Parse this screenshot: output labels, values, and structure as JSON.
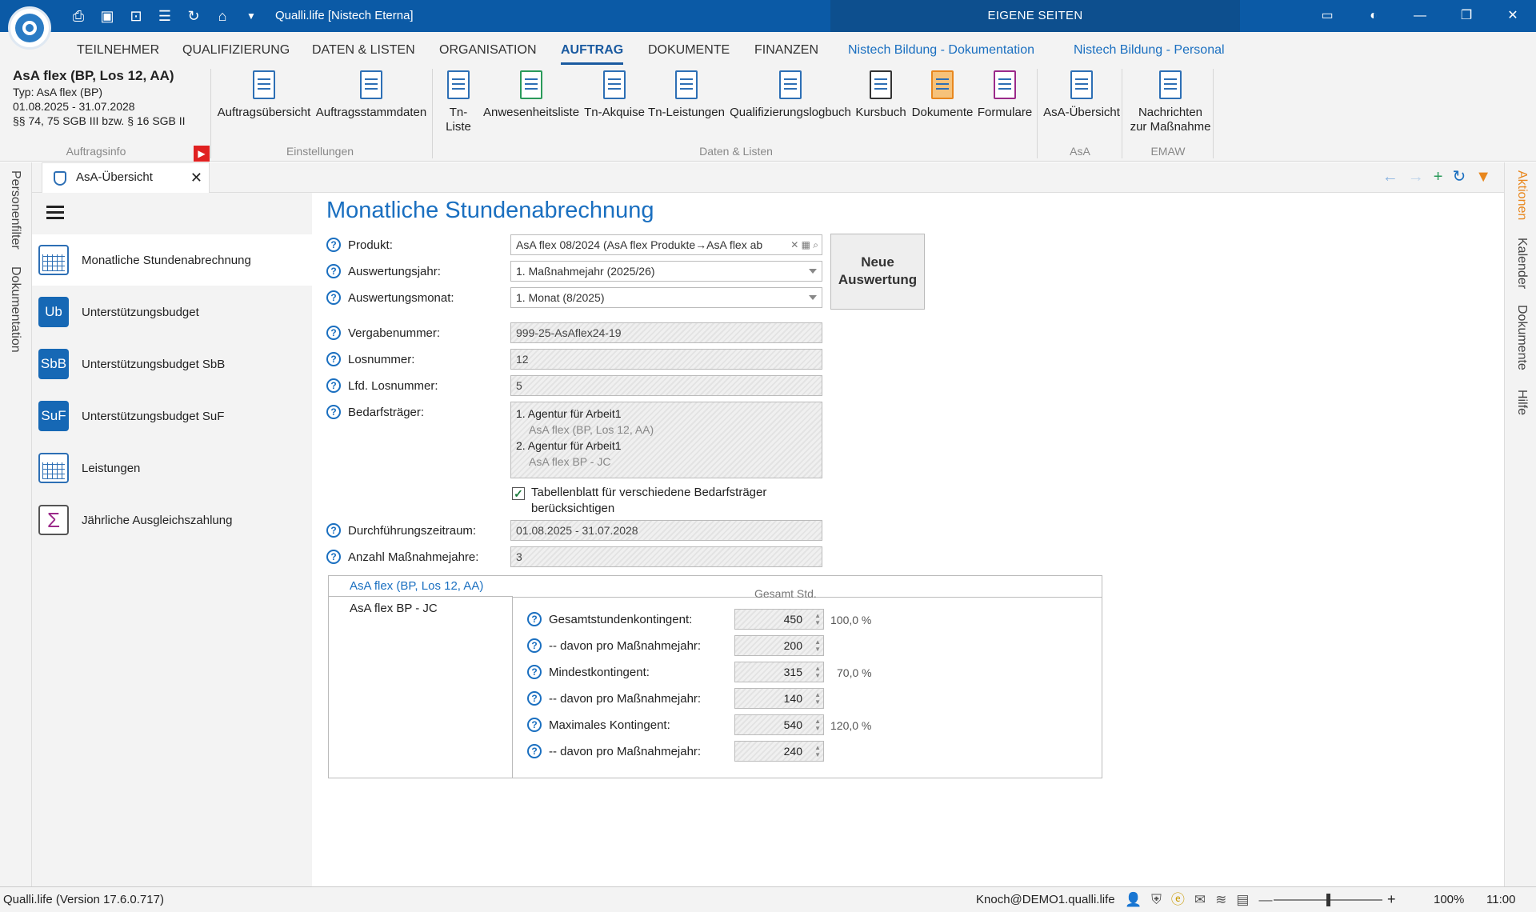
{
  "app": {
    "title": "Qualli.life [Nistech Eterna]",
    "eigene": "EIGENE SEITEN"
  },
  "menu": [
    "TEILNEHMER",
    "QUALIFIZIERUNG",
    "DATEN & LISTEN",
    "ORGANISATION",
    "AUFTRAG",
    "DOKUMENTE",
    "FINANZEN",
    "Nistech Bildung - Dokumentation",
    "Nistech Bildung - Personal"
  ],
  "auftrag": {
    "title": "AsA flex (BP, Los 12, AA)",
    "typ": "Typ: AsA flex (BP)",
    "zeit": "01.08.2025 - 31.07.2028",
    "recht": "§§ 74, 75 SGB III bzw. § 16 SGB II"
  },
  "ribbon": {
    "groups": {
      "auftragsinfo": "Auftragsinfo",
      "einstellungen": "Einstellungen",
      "daten": "Daten & Listen",
      "asa": "AsA",
      "emaw": "EMAW"
    },
    "buttons": {
      "b1": "Auftragsübersicht",
      "b2": "Auftragsstammdaten",
      "b3": "Tn-Liste",
      "b4": "Anwesenheitsliste",
      "b5": "Tn-Akquise",
      "b6": "Tn-Leistungen",
      "b7": "Qualifizierungslogbuch",
      "b8": "Kursbuch",
      "b9": "Dokumente",
      "b10": "Formulare",
      "b11": "AsA-Übersicht",
      "b12a": "Nachrichten",
      "b12b": "zur Maßnahme"
    }
  },
  "side_left": {
    "a": "Personenfilter",
    "b": "Dokumentation"
  },
  "side_right": {
    "a": "Aktionen",
    "b": "Kalender",
    "c": "Dokumente",
    "d": "Hilfe"
  },
  "tab": {
    "label": "AsA-Übersicht"
  },
  "sidebar": [
    {
      "label": "Monatliche Stundenabrechnung",
      "icon": "calendar-grid-icon"
    },
    {
      "label": "Unterstützungsbudget",
      "badge": "Ub"
    },
    {
      "label": "Unterstützungsbudget SbB",
      "badge": "SbB"
    },
    {
      "label": "Unterstützungsbudget SuF",
      "badge": "SuF"
    },
    {
      "label": "Leistungen",
      "icon": "calculator-icon"
    },
    {
      "label": "Jährliche Ausgleichszahlung",
      "icon": "sigma-icon"
    }
  ],
  "form": {
    "title": "Monatliche Stundenabrechnung",
    "produkt_l": "Produkt:",
    "produkt_v": "AsA flex 08/2024 (AsA flex Produkte→AsA flex ab",
    "jahr_l": "Auswertungsjahr:",
    "jahr_v": "1. Maßnahmejahr (2025/26)",
    "monat_l": "Auswertungsmonat:",
    "monat_v": "1. Monat (8/2025)",
    "neue1": "Neue",
    "neue2": "Auswertung",
    "vergabe_l": "Vergabenummer:",
    "vergabe_v": "999-25-AsAflex24-19",
    "los_l": "Losnummer:",
    "los_v": "12",
    "lfd_l": "Lfd. Losnummer:",
    "lfd_v": "5",
    "bedarf_l": "Bedarfsträger:",
    "bedarf": [
      {
        "name": "1. Agentur für Arbeit1",
        "sub": "AsA flex (BP, Los 12, AA)"
      },
      {
        "name": "2. Agentur für Arbeit1",
        "sub": "AsA flex BP - JC"
      }
    ],
    "chk1": "Tabellenblatt für verschiedene Bedarfsträger",
    "chk2": "berücksichtigen",
    "chk_checked": true,
    "zeit_l": "Durchführungszeitraum:",
    "zeit_v": "01.08.2025 - 31.07.2028",
    "anzahl_l": "Anzahl Maßnahmejahre:",
    "anzahl_v": "3"
  },
  "panel": {
    "tabs": [
      "AsA flex (BP, Los 12, AA)",
      "AsA flex BP - JC"
    ],
    "col": "Gesamt Std.",
    "rows": [
      {
        "label": "Gesamtstundenkontingent:",
        "value": "450",
        "pct": "100,0 %"
      },
      {
        "label": "-- davon pro Maßnahmejahr:",
        "value": "200",
        "pct": ""
      },
      {
        "label": "Mindestkontingent:",
        "value": "315",
        "pct": "70,0 %"
      },
      {
        "label": "-- davon pro Maßnahmejahr:",
        "value": "140",
        "pct": ""
      },
      {
        "label": "Maximales Kontingent:",
        "value": "540",
        "pct": "120,0 %"
      },
      {
        "label": "-- davon pro Maßnahmejahr:",
        "value": "240",
        "pct": ""
      }
    ]
  },
  "status": {
    "version": "Qualli.life (Version 17.6.0.717)",
    "user": "Knoch@DEMO1.qualli.life",
    "zoom": "100%",
    "time": "11:00",
    "zoom_level": 0.5
  },
  "colors": {
    "brand": "#0b5aa6",
    "accent": "#1a6fc0",
    "orange": "#e8871e"
  }
}
